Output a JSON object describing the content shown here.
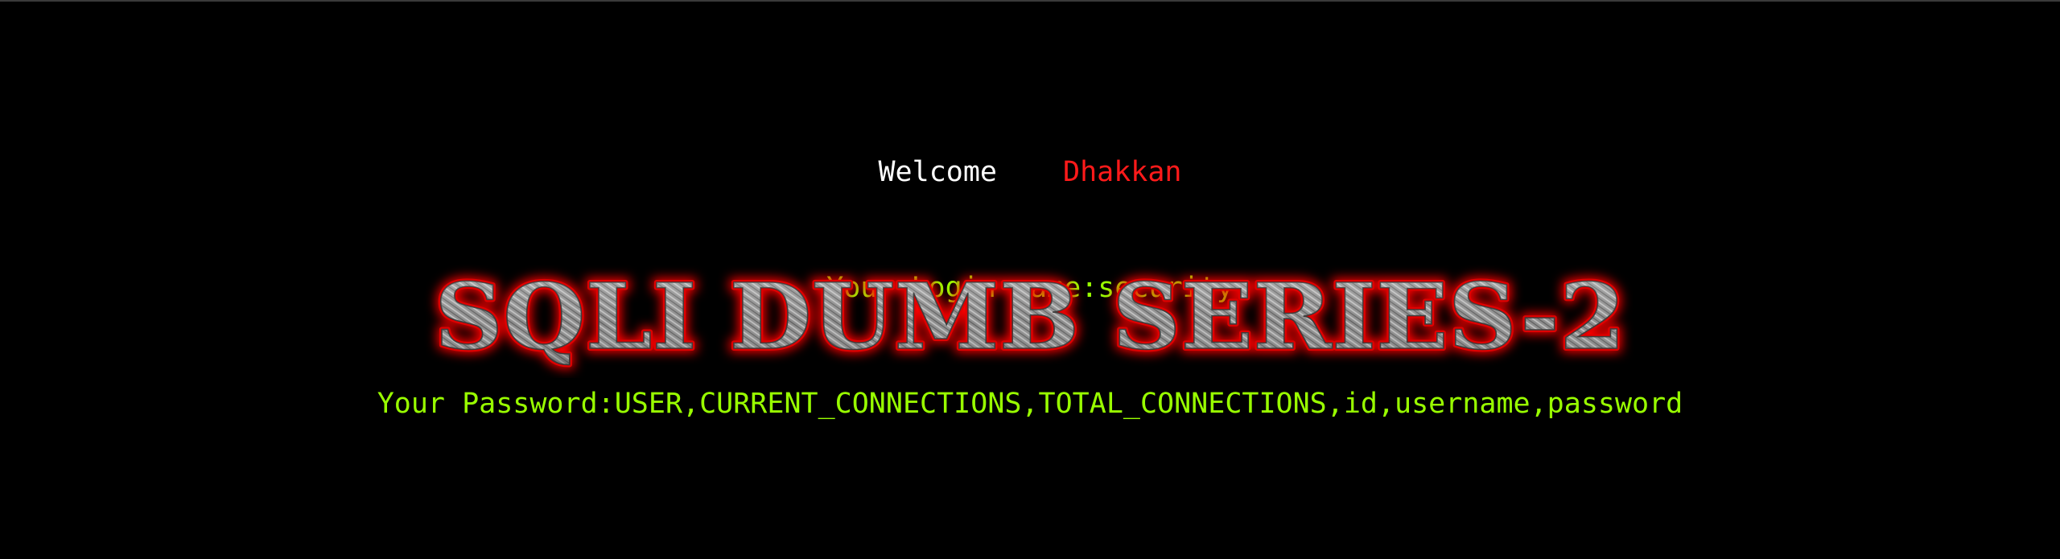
{
  "greeting": {
    "welcome_label": "Welcome",
    "user_name": "Dhakkan"
  },
  "login": {
    "login_name_label": "Your Login name:",
    "login_name_value": "security",
    "password_label": "Your Password:",
    "password_value": "USER,CURRENT_CONNECTIONS,TOTAL_CONNECTIONS,id,username,password"
  },
  "banner": {
    "title": "SQLI DUMB SERIES-2"
  },
  "colors": {
    "background": "#000000",
    "welcome_text": "#ffffff",
    "user_name": "#ff1a1a",
    "info_text": "#99ff00",
    "banner_glow": "#ff0000",
    "banner_fill": "#9a9a9a"
  }
}
